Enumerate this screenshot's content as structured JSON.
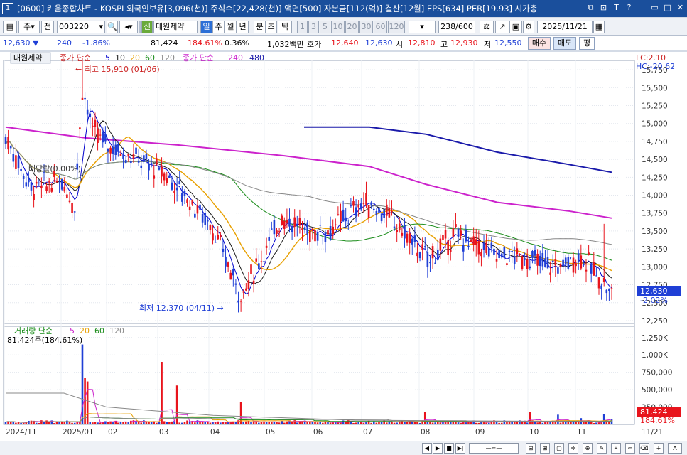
{
  "window": {
    "number": "1",
    "title": "[0600] 키움종합차트 - KOSPI 외국인보유[3,096(천)] 주식수[22,428(천)] 액면[500] 자본금[112(억)] 결산[12월] EPS[634] PER[19.93] 시가총"
  },
  "toolbar": {
    "period_mode": "주",
    "prev_label": "전",
    "code": "003220",
    "credit_badge": "신",
    "stock_name": "대원제약",
    "periods": [
      "일",
      "주",
      "월",
      "년",
      "분",
      "초",
      "틱"
    ],
    "minute_options": [
      "1",
      "3",
      "5",
      "10",
      "20",
      "30",
      "60",
      "120"
    ],
    "count": "238",
    "max_count": "/600",
    "date": "2025/11/21"
  },
  "quote": {
    "price": "12,630",
    "change_arrow": "▼",
    "change": "240",
    "change_pct": "-1.86%",
    "volume": "81,424",
    "volume_ratio": "184.61%",
    "turnover": "0.36%",
    "amount": "1,032백만",
    "ask_label": "호가",
    "ask": "12,640",
    "bid": "12,630",
    "open_label": "시",
    "open": "12,810",
    "high_label": "고",
    "high": "12,930",
    "low_label": "저",
    "low": "12,550",
    "buy_label": "매수",
    "sell_label": "매도",
    "flat_label": "평"
  },
  "price_panel": {
    "stock_label": "대원제약",
    "legend_prefix": "종가 단순",
    "ma": [
      {
        "period": "5",
        "color": "#0000cc"
      },
      {
        "period": "10",
        "color": "#1a1a1a"
      },
      {
        "period": "20",
        "color": "#e8a000"
      },
      {
        "period": "60",
        "color": "#1a8c1a"
      },
      {
        "period": "120",
        "color": "#888888"
      }
    ],
    "legend2_prefix": "종가 단순",
    "ma_long": [
      {
        "period": "240",
        "color": "#cc22cc"
      },
      {
        "period": "480",
        "color": "#1a1aaa"
      }
    ],
    "lc": "LC:2.10",
    "hc": "HC:-20.62",
    "high_marker": "최고 15,910 (01/06)",
    "low_marker": "최저 12,370 (04/11)",
    "dividend": "배당락(0.00%)",
    "current_label": "12,630",
    "current_pct": "-2.02%",
    "y_ticks": [
      "15,750",
      "15,500",
      "15,250",
      "15,000",
      "14,750",
      "14,500",
      "14,250",
      "14,000",
      "13,750",
      "13,500",
      "13,250",
      "13,000",
      "12,750",
      "12,500",
      "12,250"
    ]
  },
  "volume_panel": {
    "legend_prefix": "거래량 단순",
    "ma": [
      {
        "period": "5",
        "color": "#cc22cc"
      },
      {
        "period": "20",
        "color": "#e8a000"
      },
      {
        "period": "60",
        "color": "#1a8c1a"
      },
      {
        "period": "120",
        "color": "#888888"
      }
    ],
    "volume_text": "81,424주(184.61%)",
    "current_label": "81,424",
    "current_pct": "184.61%",
    "y_ticks": [
      "1,250K",
      "1,000K",
      "750,000",
      "500,000",
      "250,000"
    ]
  },
  "x_axis": {
    "labels": [
      "2024/11",
      "2025/01",
      "02",
      "03",
      "04",
      "05",
      "06",
      "07",
      "08",
      "09",
      "10",
      "11"
    ],
    "right_label": "11/21"
  },
  "bottom": {
    "right_label": "A"
  },
  "colors": {
    "up": "#e8141c",
    "down": "#1f3fd6",
    "accent": "#1a4f9c"
  }
}
